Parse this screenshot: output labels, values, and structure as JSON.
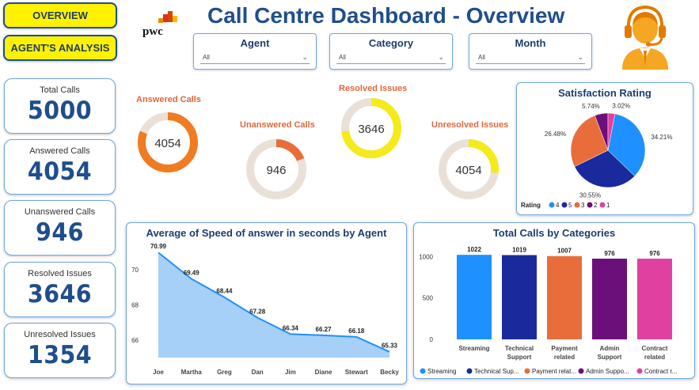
{
  "nav": {
    "overview": "OVERVIEW",
    "agents_analysis": "AGENT'S ANALYSIS"
  },
  "logo": {
    "text": "pwc"
  },
  "title": "Call Centre Dashboard - Overview",
  "filters": [
    {
      "label": "Agent",
      "value": "All"
    },
    {
      "label": "Category",
      "value": "All"
    },
    {
      "label": "Month",
      "value": "All"
    }
  ],
  "kpis": [
    {
      "label": "Total Calls",
      "value": "5000"
    },
    {
      "label": "Answered Calls",
      "value": "4054"
    },
    {
      "label": "Unanswered Calls",
      "value": "946"
    },
    {
      "label": "Resolved Issues",
      "value": "3646"
    },
    {
      "label": "Unresolved Issues",
      "value": "1354"
    }
  ],
  "donuts": [
    {
      "label": "Answered Calls",
      "value": "4054",
      "fraction": 0.8108,
      "color": "#f07b21"
    },
    {
      "label": "Unanswered Calls",
      "value": "946",
      "fraction": 0.1892,
      "color": "#e86d3a"
    },
    {
      "label": "Resolved Issues",
      "value": "3646",
      "fraction": 0.7292,
      "color": "#f5ea1a"
    },
    {
      "label": "Unresolved Issues",
      "value": "4054",
      "fraction": 0.2708,
      "color": "#f5ea1a"
    }
  ],
  "donut_track_color": "#e9e1d8",
  "chart_data": [
    {
      "type": "pie",
      "title": "Satisfaction Rating",
      "legend_title": "Rating",
      "categories": [
        "4",
        "5",
        "3",
        "2",
        "1"
      ],
      "values": [
        34.21,
        30.55,
        26.48,
        5.74,
        3.02
      ],
      "labels": [
        "34.21%",
        "30.55%",
        "26.48%",
        "5.74%",
        "3.02%"
      ],
      "colors": [
        "#1e90ff",
        "#1a2a9c",
        "#e86d3a",
        "#6b0f7a",
        "#e040a0"
      ],
      "legend_placement": "bottom-left"
    },
    {
      "type": "area",
      "title": "Average of Speed of answer in seconds by Agent",
      "categories": [
        "Joe",
        "Martha",
        "Greg",
        "Dan",
        "Jim",
        "Diane",
        "Stewart",
        "Becky"
      ],
      "values": [
        70.99,
        69.49,
        68.44,
        67.28,
        66.34,
        66.27,
        66.18,
        65.33
      ],
      "value_labels": [
        "70.99",
        "69.49",
        "68.44",
        "67.28",
        "66.34",
        "66.27",
        "66.18",
        "65.33"
      ],
      "yticks": [
        "70",
        "68",
        "66"
      ],
      "ytick_values": [
        70,
        68,
        66
      ],
      "ylim": [
        65,
        71
      ],
      "colors": {
        "line": "#1e90ff",
        "fill": "#a6d0f7"
      }
    },
    {
      "type": "bar",
      "title": "Total Calls by Categories",
      "categories": [
        "Streaming",
        "Technical Support",
        "Payment related",
        "Admin Support",
        "Contract related"
      ],
      "category_lines": [
        [
          "Streaming"
        ],
        [
          "Technical",
          "Support"
        ],
        [
          "Payment",
          "related"
        ],
        [
          "Admin",
          "Support"
        ],
        [
          "Contract",
          "related"
        ]
      ],
      "values": [
        1022,
        1019,
        1007,
        976,
        976
      ],
      "value_labels": [
        "1022",
        "1019",
        "1007",
        "976",
        "976"
      ],
      "yticks": [
        "1000",
        "500",
        "0"
      ],
      "ytick_values": [
        1000,
        500,
        0
      ],
      "ylim": [
        0,
        1100
      ],
      "colors": [
        "#1e90ff",
        "#1a2a9c",
        "#e86d3a",
        "#6b0f7a",
        "#e040a0"
      ],
      "legend": [
        "Streaming",
        "Technical Sup...",
        "Payment relat...",
        "Admin Suppo...",
        "Contract r..."
      ],
      "legend_placement": "bottom"
    }
  ],
  "agent_icon": "call-center-agent-headset-icon"
}
